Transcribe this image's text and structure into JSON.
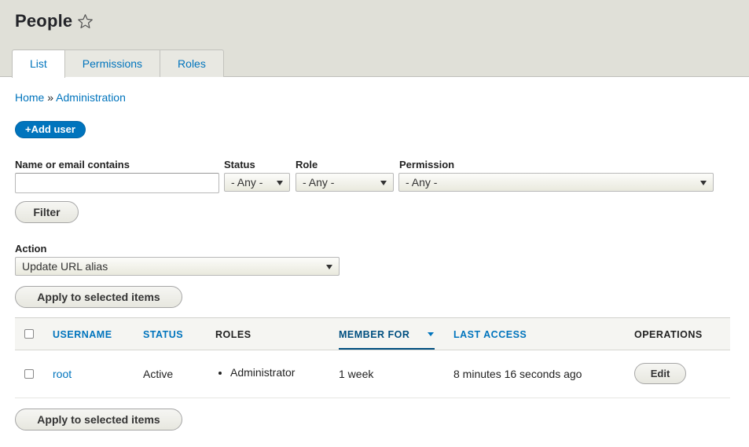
{
  "header": {
    "title": "People",
    "favorite_icon": "star-icon",
    "tabs": [
      {
        "label": "List",
        "active": true
      },
      {
        "label": "Permissions",
        "active": false
      },
      {
        "label": "Roles",
        "active": false
      }
    ]
  },
  "breadcrumb": {
    "items": [
      "Home",
      "Administration"
    ],
    "separator": "»"
  },
  "actions": {
    "add_user": "+Add user"
  },
  "filters": {
    "name_label": "Name or email contains",
    "name_value": "",
    "status_label": "Status",
    "status_value": "- Any -",
    "role_label": "Role",
    "role_value": "- Any -",
    "permission_label": "Permission",
    "permission_value": "- Any -",
    "filter_button": "Filter"
  },
  "bulk": {
    "action_label": "Action",
    "action_value": "Update URL alias",
    "apply_top": "Apply to selected items",
    "apply_bottom": "Apply to selected items"
  },
  "table": {
    "columns": [
      "USERNAME",
      "STATUS",
      "ROLES",
      "MEMBER FOR",
      "LAST ACCESS",
      "OPERATIONS"
    ],
    "sorted_column": "MEMBER FOR",
    "rows": [
      {
        "username": "root",
        "status": "Active",
        "roles": [
          "Administrator"
        ],
        "member_for": "1 week",
        "last_access": "8 minutes 16 seconds ago",
        "operation": "Edit"
      }
    ]
  },
  "colors": {
    "accent": "#0074bd",
    "header_bg": "#e0e0d8"
  }
}
